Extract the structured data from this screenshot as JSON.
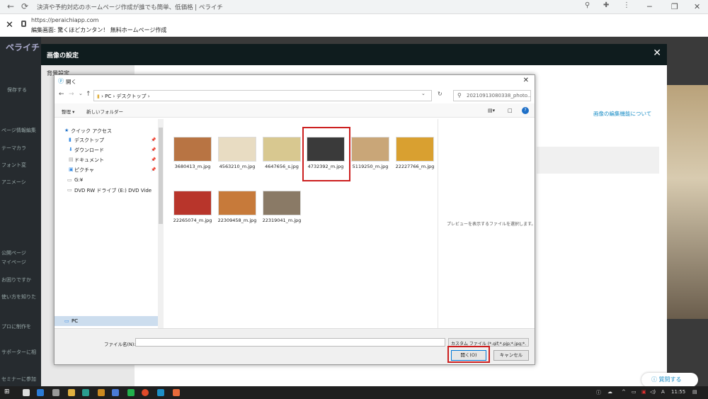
{
  "browser": {
    "tab_title": "決済や予約対応のホームページ作成が誰でも簡単、低価格 | ペライチ",
    "url": "https://peraichiapp.com",
    "page_title": "編集画面: 驚くほどカンタン！ 無料ホームページ作成"
  },
  "sidebar": {
    "logo": "ペライチ",
    "items": [
      "保存する",
      "ページ情報編集",
      "テーマカラ",
      "フォント変",
      "アニメーシ",
      "公開ページ",
      "マイページ",
      "お困りですか",
      "使い方を知りた",
      "プロに制作を",
      "サポーターに相",
      "セミナーに参加"
    ]
  },
  "modal": {
    "title": "画像の設定",
    "left_label": "背景設定",
    "help_link": "画像の編集機能について"
  },
  "dialog": {
    "title": "開く",
    "breadcrumb": [
      "PC",
      "デスクトップ"
    ],
    "search_placeholder": "20210913080338_photo...",
    "organize": "整理 ▾",
    "new_folder": "新しいフォルダー",
    "nav": {
      "quick_access": "クイック アクセス",
      "items": [
        "デスクトップ",
        "ダウンロード",
        "ドキュメント",
        "ピクチャ"
      ],
      "g_drive": "G:¥",
      "dvd": "DVD RW ドライブ (E:) DVD Vide",
      "pc": "PC"
    },
    "files": [
      {
        "name": "3680413_m.jpg",
        "color": "#b87443"
      },
      {
        "name": "4563210_m.jpg",
        "color": "#e8dcc2"
      },
      {
        "name": "4647656_s.jpg",
        "color": "#d8c890"
      },
      {
        "name": "4732392_m.jpg",
        "color": "#3a3a3a"
      },
      {
        "name": "5119250_m.jpg",
        "color": "#c9a678"
      },
      {
        "name": "22227766_m.jpg",
        "color": "#d9a030"
      },
      {
        "name": "22265074_m.jpg",
        "color": "#b8352b"
      },
      {
        "name": "22309458_m.jpg",
        "color": "#c77a3a"
      },
      {
        "name": "22319041_m.jpg",
        "color": "#8a7a66"
      }
    ],
    "preview_text": "プレビューを表示するファイルを選択します。",
    "filename_label": "ファイル名(N):",
    "filetype": "カスタム ファイル (*.gif;*.pjp;*.jpg;*.",
    "open_button": "開く(O)",
    "cancel_button": "キャンセル"
  },
  "ask_button": "質問する",
  "taskbar": {
    "time": "11:55",
    "ime": "A"
  }
}
